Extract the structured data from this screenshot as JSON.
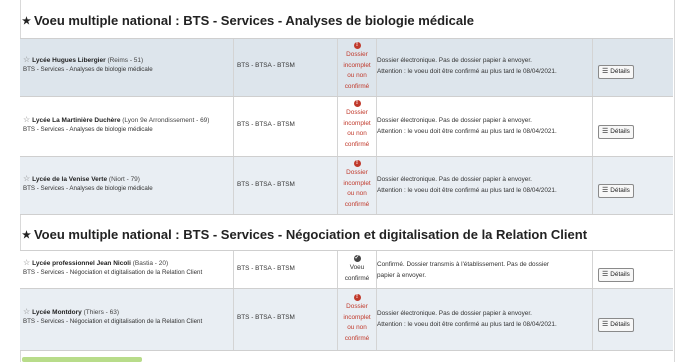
{
  "sections": [
    {
      "title": "Voeu multiple national : BTS - Services - Analyses de biologie médicale",
      "rows": [
        {
          "name": "Lycée Hugues Libergier",
          "location": "(Reims - 51)",
          "subtitle": "BTS - Services - Analyses de biologie médicale",
          "type": "BTS - BTSA - BTSM",
          "status_icon": "!",
          "status_lines": [
            "Dossier",
            "incomplet",
            "ou non",
            "confirmé"
          ],
          "message_lines": [
            "Dossier électronique. Pas de dossier papier à envoyer.",
            "Attention : le voeu doit être confirmé au plus tard le 08/04/2021."
          ],
          "button": "Détails"
        },
        {
          "name": "Lycée La Martinière Duchère",
          "location": "(Lyon 9e Arrondissement - 69)",
          "subtitle": "BTS - Services - Analyses de biologie médicale",
          "type": "BTS - BTSA - BTSM",
          "status_icon": "!",
          "status_lines": [
            "Dossier",
            "incomplet",
            "ou non",
            "confirmé"
          ],
          "message_lines": [
            "Dossier électronique. Pas de dossier papier à envoyer.",
            "Attention : le voeu doit être confirmé au plus tard le 08/04/2021."
          ],
          "button": "Détails"
        },
        {
          "name": "Lycée de la Venise Verte",
          "location": "(Niort - 79)",
          "subtitle": "BTS - Services - Analyses de biologie médicale",
          "type": "BTS - BTSA - BTSM",
          "status_icon": "!",
          "status_lines": [
            "Dossier",
            "incomplet",
            "ou non",
            "confirmé"
          ],
          "message_lines": [
            "Dossier électronique. Pas de dossier papier à envoyer.",
            "Attention : le voeu doit être confirmé au plus tard le 08/04/2021."
          ],
          "button": "Détails"
        }
      ]
    },
    {
      "title": "Voeu multiple national : BTS - Services - Négociation et digitalisation de la Relation Client",
      "rows": [
        {
          "name": "Lycée professionnel Jean Nicoli",
          "location": "(Bastia - 20)",
          "subtitle": "BTS - Services - Négociation et digitalisation de la Relation Client",
          "type": "BTS - BTSA - BTSM",
          "status_icon": "✓",
          "status_lines": [
            "Voeu",
            "confirmé"
          ],
          "message_lines": [
            "Confirmé. Dossier transmis à l'établissement. Pas de dossier",
            "papier à envoyer."
          ],
          "button": "Détails"
        },
        {
          "name": "Lycée Montdory",
          "location": "(Thiers - 63)",
          "subtitle": "BTS - Services - Négociation et digitalisation de la Relation Client",
          "type": "BTS - BTSA - BTSM",
          "status_icon": "!",
          "status_lines": [
            "Dossier",
            "incomplet",
            "ou non",
            "confirmé"
          ],
          "message_lines": [
            "Dossier électronique. Pas de dossier papier à envoyer.",
            "Attention : le voeu doit être confirmé au plus tard le 08/04/2021."
          ],
          "button": "Détails"
        }
      ]
    }
  ],
  "colors": {
    "error": "#c0392b",
    "row_alt": "#e9eef3",
    "row_highlight": "#dde5ec"
  }
}
